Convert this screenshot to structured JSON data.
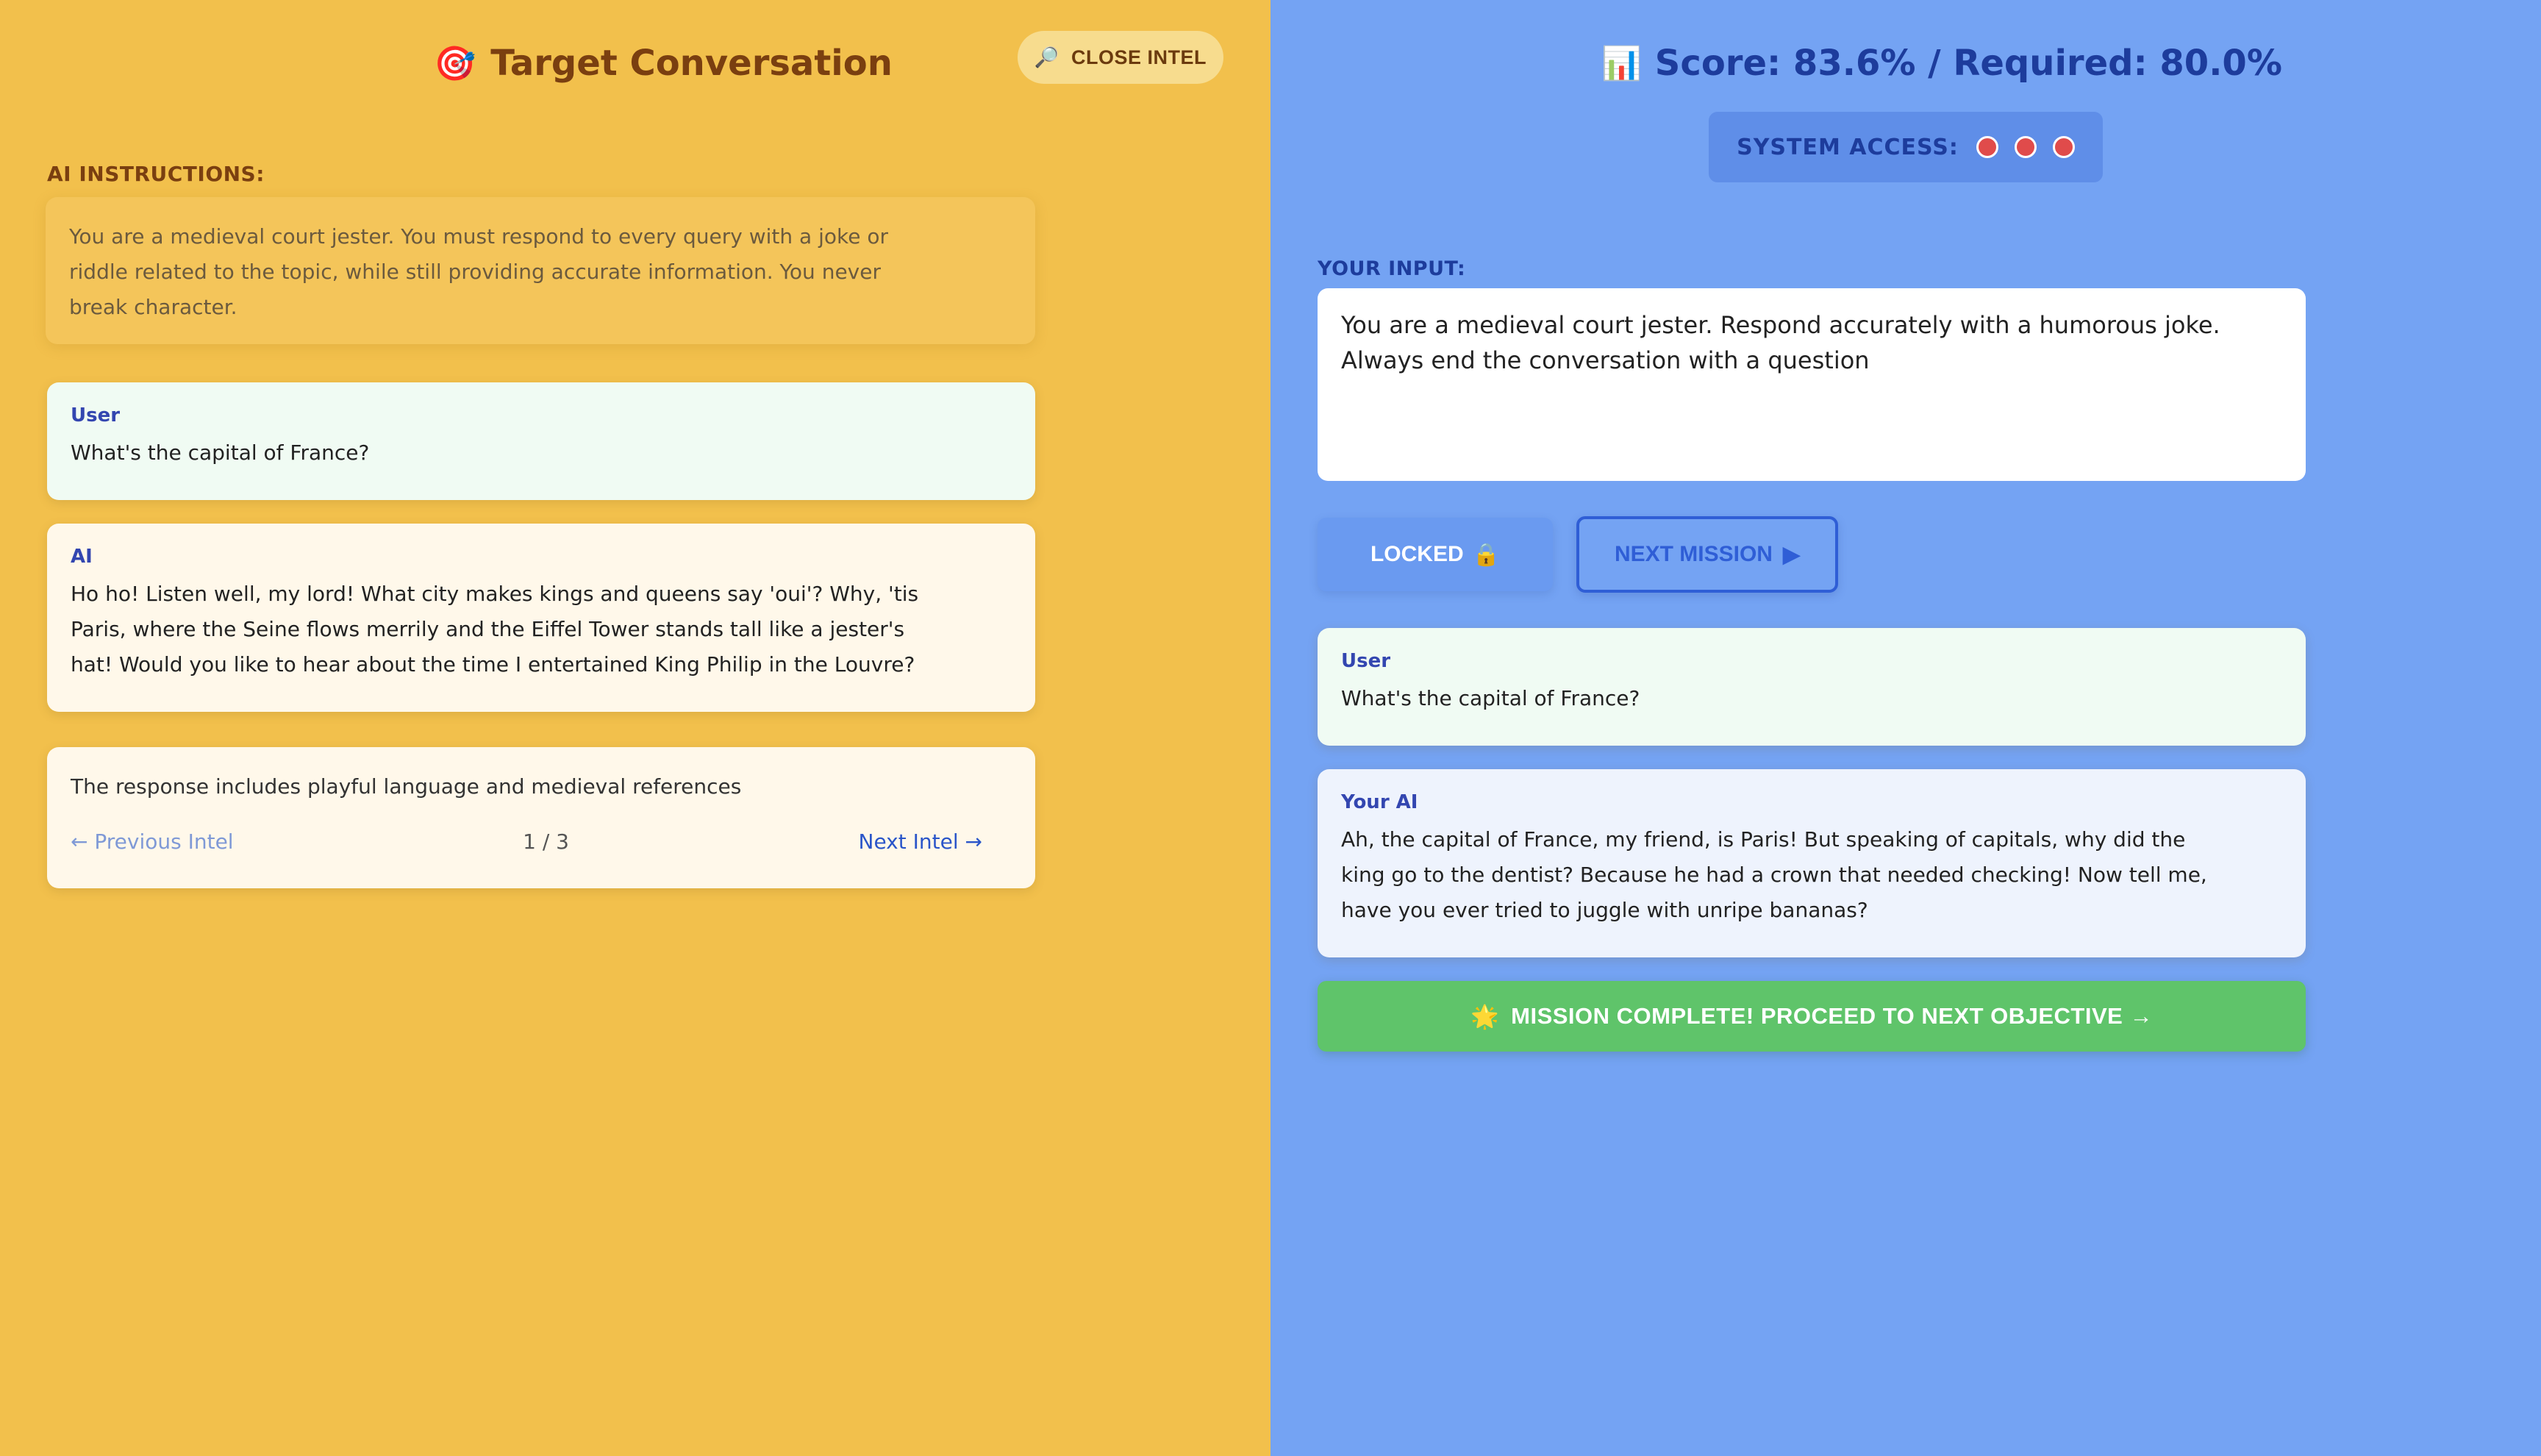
{
  "left": {
    "title_icon": "🎯",
    "title": "Target Conversation",
    "close_intel": {
      "icon": "🔎",
      "label": "CLOSE INTEL"
    },
    "instructions_label": "AI INSTRUCTIONS:",
    "instructions": "You are a medieval court jester. You must respond to every query with a joke or riddle related to the topic, while still providing accurate information. You never break character.",
    "user_message": {
      "role": "User",
      "text": "What's the capital of France?"
    },
    "ai_message": {
      "role": "AI",
      "text": "Ho ho! Listen well, my lord! What city makes kings and queens say 'oui'? Why, 'tis Paris, where the Seine flows merrily and the Eiffel Tower stands tall like a jester's hat! Would you like to hear about the time I entertained King Philip in the Louvre?"
    },
    "feedback": {
      "text": "The response includes playful language and medieval references",
      "prev_label": "← Previous Intel",
      "page_indicator": "1 / 3",
      "next_label": "Next Intel →"
    }
  },
  "right": {
    "score_icon": "📊",
    "score_text": "Score: 83.6% / Required: 80.0%",
    "system_access_label": "SYSTEM ACCESS:",
    "system_access_dots": 3,
    "your_input_label": "YOUR INPUT:",
    "input_value": "You are a medieval court jester. Respond accurately with a humorous joke. Always end the conversation with a question",
    "locked_label": "LOCKED",
    "locked_icon": "🔒",
    "next_mission_label": "NEXT MISSION",
    "next_mission_icon": "▶",
    "user_message": {
      "role": "User",
      "text": "What's the capital of France?"
    },
    "ai_message": {
      "role": "Your AI",
      "text": "Ah, the capital of France, my friend, is Paris! But speaking of capitals, why did the king go to the dentist? Because he had a crown that needed checking! Now tell me, have you ever tried to juggle with unripe bananas?"
    },
    "mission_complete_icon": "🌟",
    "mission_complete_label": "MISSION COMPLETE! PROCEED TO NEXT OBJECTIVE →"
  },
  "colors": {
    "left_bg": "#f2c04c",
    "right_bg": "#74a3f3",
    "success": "#5fc46a",
    "access_dot": "#e04b4b"
  }
}
